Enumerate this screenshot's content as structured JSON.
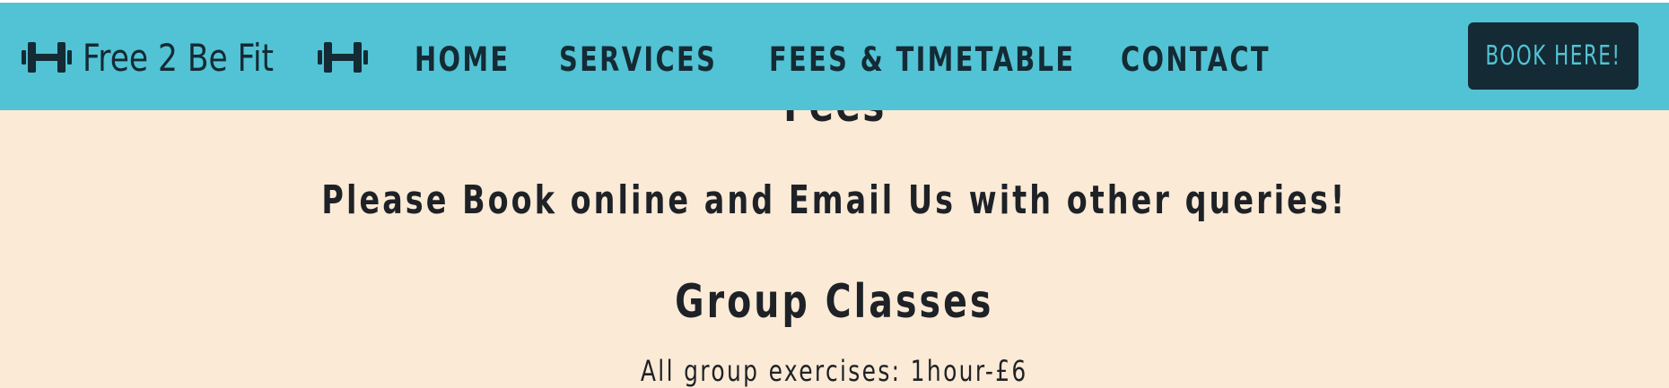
{
  "header": {
    "brand": "Free 2 Be Fit",
    "brand_icon": "dumbbell-icon",
    "nav": [
      {
        "label": "HOME"
      },
      {
        "label": "SERVICES"
      },
      {
        "label": "FEES & TIMETABLE"
      },
      {
        "label": "CONTACT"
      }
    ],
    "book_label": "BOOK HERE!"
  },
  "main": {
    "section_title": "Fees",
    "tagline": "Please Book online and Email Us with other queries!",
    "group_title": "Group Classes",
    "group_desc": "All group exercises: 1hour-£6"
  },
  "colors": {
    "navbar": "#51c3d4",
    "background": "#fbead6",
    "dark": "#142a34",
    "text": "#1e2227"
  }
}
